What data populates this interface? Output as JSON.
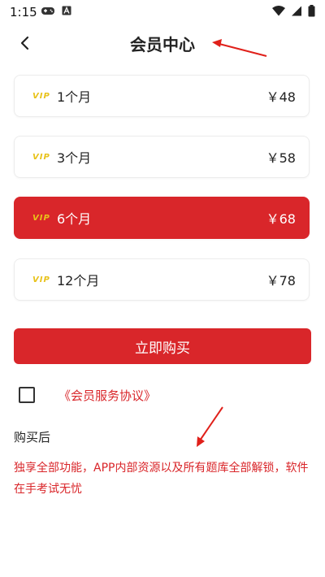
{
  "status_bar": {
    "time": "1:15"
  },
  "header": {
    "title": "会员中心"
  },
  "plans": [
    {
      "tag": "VIP",
      "name": "1个月",
      "price": "￥48",
      "selected": false
    },
    {
      "tag": "VIP",
      "name": "3个月",
      "price": "￥58",
      "selected": false
    },
    {
      "tag": "VIP",
      "name": "6个月",
      "price": "￥68",
      "selected": true
    },
    {
      "tag": "VIP",
      "name": "12个月",
      "price": "￥78",
      "selected": false
    }
  ],
  "buy_button": {
    "label": "立即购买"
  },
  "agreement": {
    "link_text": "《会员服务协议》",
    "checked": false
  },
  "after_purchase": {
    "title": "购买后",
    "description": "独享全部功能，APP内部资源以及所有题库全部解锁，软件在手考试无忧"
  },
  "colors": {
    "accent": "#d9262a",
    "vip_tag": "#e8c21a"
  }
}
